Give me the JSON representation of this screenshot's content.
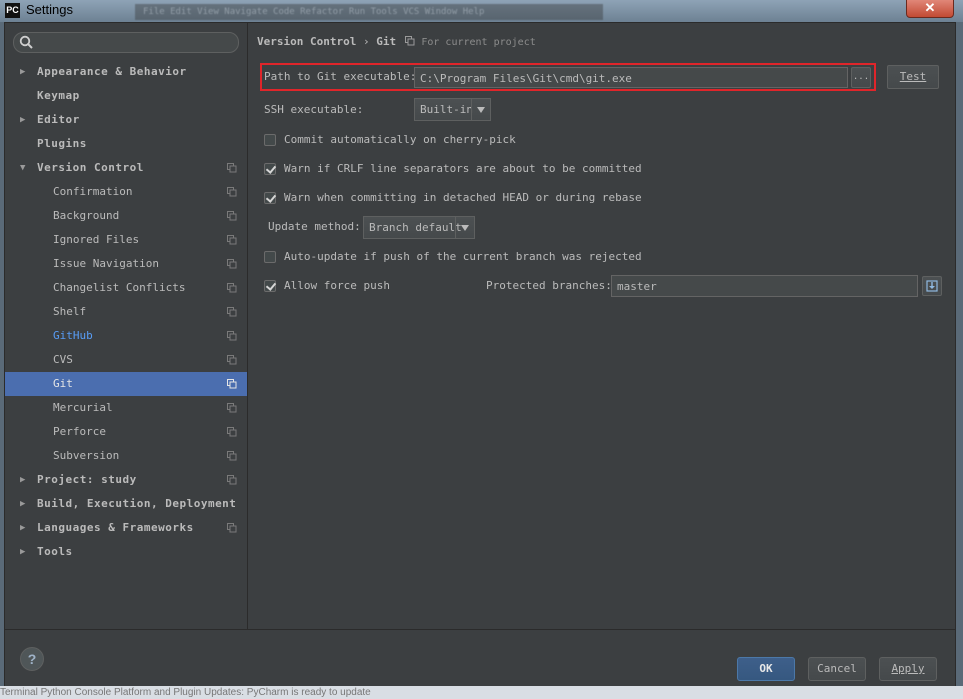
{
  "window": {
    "app_badge": "PC",
    "title": "Settings",
    "close_glyph": "✕",
    "background_menu": "File  Edit  View  Navigate  Code  Refactor  Run  Tools  VCS  Window  Help"
  },
  "sidebar": {
    "search_placeholder": "",
    "items": [
      {
        "label": "Appearance & Behavior",
        "level": 0,
        "arrow": "right"
      },
      {
        "label": "Keymap",
        "level": 0,
        "arrow": ""
      },
      {
        "label": "Editor",
        "level": 0,
        "arrow": "right"
      },
      {
        "label": "Plugins",
        "level": 0,
        "arrow": ""
      },
      {
        "label": "Version Control",
        "level": 0,
        "arrow": "down"
      },
      {
        "label": "Confirmation",
        "level": 1
      },
      {
        "label": "Background",
        "level": 1
      },
      {
        "label": "Ignored Files",
        "level": 1
      },
      {
        "label": "Issue Navigation",
        "level": 1
      },
      {
        "label": "Changelist Conflicts",
        "level": 1
      },
      {
        "label": "Shelf",
        "level": 1
      },
      {
        "label": "GitHub",
        "level": 1
      },
      {
        "label": "CVS",
        "level": 1
      },
      {
        "label": "Git",
        "level": 1
      },
      {
        "label": "Mercurial",
        "level": 1
      },
      {
        "label": "Perforce",
        "level": 1
      },
      {
        "label": "Subversion",
        "level": 1
      },
      {
        "label": "Project: study",
        "level": 0,
        "arrow": "right"
      },
      {
        "label": "Build, Execution, Deployment",
        "level": 0,
        "arrow": "right"
      },
      {
        "label": "Languages & Frameworks",
        "level": 0,
        "arrow": "right"
      },
      {
        "label": "Tools",
        "level": 0,
        "arrow": "right"
      }
    ]
  },
  "breadcrumb": {
    "section": "Version Control",
    "separator": "›",
    "page": "Git",
    "note": "For current project"
  },
  "git": {
    "path_label": "Path to Git executable:",
    "path_value": "C:\\Program Files\\Git\\cmd\\git.exe",
    "browse_label": "...",
    "test_label": "Test",
    "ssh_label": "SSH executable:",
    "ssh_value": "Built-in",
    "commit_cherry_pick": {
      "label": "Commit automatically on cherry-pick",
      "checked": false
    },
    "warn_crlf": {
      "label": "Warn if CRLF line separators are about to be committed",
      "checked": true
    },
    "warn_detached": {
      "label": "Warn when committing in detached HEAD or during rebase",
      "checked": true
    },
    "update_method_label": "Update method:",
    "update_method_value": "Branch default",
    "auto_update": {
      "label": "Auto-update if push of the current branch was rejected",
      "checked": false
    },
    "allow_force_push": {
      "label": "Allow force push",
      "checked": true
    },
    "protected_label": "Protected branches:",
    "protected_value": "master"
  },
  "footer": {
    "help_label": "?",
    "ok_label": "OK",
    "cancel_label": "Cancel",
    "apply_label": "Apply"
  },
  "taskbar": {
    "text": "Terminal   Python Console   Platform and Plugin Updates: PyCharm is ready to update"
  },
  "colors": {
    "highlight_border": "#e0252a",
    "selected_row": "#4b6eaf",
    "link": "#589df6",
    "panel": "#3c3f41"
  }
}
